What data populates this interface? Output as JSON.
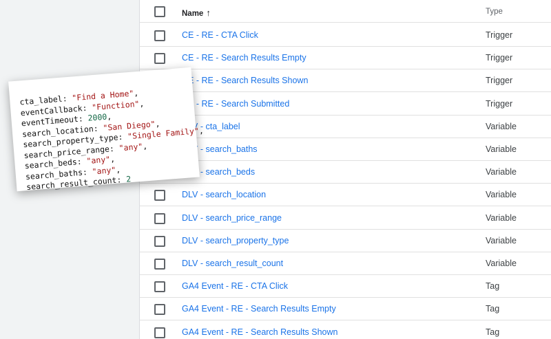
{
  "table": {
    "header": {
      "name": "Name",
      "sort_arrow": "↑",
      "type": "Type"
    },
    "rows": [
      {
        "name": "CE - RE - CTA Click",
        "type": "Trigger"
      },
      {
        "name": "CE - RE - Search Results Empty",
        "type": "Trigger"
      },
      {
        "name": "CE - RE - Search Results Shown",
        "type": "Trigger"
      },
      {
        "name": "CE - RE - Search Submitted",
        "type": "Trigger"
      },
      {
        "name": "DLV - cta_label",
        "type": "Variable"
      },
      {
        "name": "DLV - search_baths",
        "type": "Variable"
      },
      {
        "name": "DLV - search_beds",
        "type": "Variable"
      },
      {
        "name": "DLV - search_location",
        "type": "Variable"
      },
      {
        "name": "DLV - search_price_range",
        "type": "Variable"
      },
      {
        "name": "DLV - search_property_type",
        "type": "Variable"
      },
      {
        "name": "DLV - search_result_count",
        "type": "Variable"
      },
      {
        "name": "GA4 Event - RE - CTA Click",
        "type": "Tag"
      },
      {
        "name": "GA4 Event - RE - Search Results Empty",
        "type": "Tag"
      },
      {
        "name": "GA4 Event - RE - Search Results Shown",
        "type": "Tag"
      }
    ]
  },
  "snippet": {
    "lines": [
      {
        "key": "cta_label: ",
        "value": "\"Find a Home\"",
        "kind": "s",
        "trail": ","
      },
      {
        "key": "eventCallback: ",
        "value": "\"Function\"",
        "kind": "s",
        "trail": ","
      },
      {
        "key": "eventTimeout: ",
        "value": "2000",
        "kind": "n",
        "trail": ","
      },
      {
        "key": "search_location: ",
        "value": "\"San Diego\"",
        "kind": "s",
        "trail": ","
      },
      {
        "key": "search_property_type: ",
        "value": "\"Single Family\"",
        "kind": "s",
        "trail": ","
      },
      {
        "key": "search_price_range: ",
        "value": "\"any\"",
        "kind": "s",
        "trail": ","
      },
      {
        "key": "search_beds: ",
        "value": "\"any\"",
        "kind": "s",
        "trail": ","
      },
      {
        "key": "search_baths: ",
        "value": "\"any\"",
        "kind": "s",
        "trail": ","
      },
      {
        "key": "search_result_count: ",
        "value": "2",
        "kind": "n",
        "trail": ""
      }
    ]
  },
  "colors": {
    "link": "#1a73e8",
    "string": "#a31515",
    "number": "#116644"
  }
}
